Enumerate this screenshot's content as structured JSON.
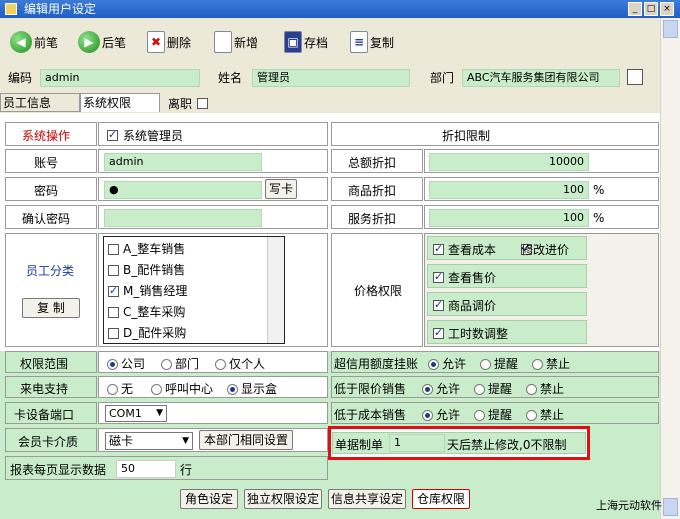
{
  "window": {
    "title": "编辑用户设定"
  },
  "toolbar": {
    "prev": "前笔",
    "next": "后笔",
    "delete": "删除",
    "add": "新增",
    "save": "存档",
    "copy": "复制"
  },
  "header": {
    "code_label": "编码",
    "code_value": "admin",
    "name_label": "姓名",
    "name_value": "管理员",
    "dept_label": "部门",
    "dept_value": "ABC汽车服务集团有限公司"
  },
  "tabs": {
    "employee": "员工信息",
    "system": "系统权限",
    "resign": "离职"
  },
  "left": {
    "sysop_label": "系统操作",
    "sysadmin_label": "系统管理员",
    "account_label": "账号",
    "account_value": "admin",
    "password_label": "密码",
    "password_value": "●",
    "write_card": "写卡",
    "confirm_label": "确认密码",
    "category_label": "员工分类",
    "copy_btn": "复 制",
    "categories": [
      {
        "label": "A_整车销售",
        "checked": false
      },
      {
        "label": "B_配件销售",
        "checked": false
      },
      {
        "label": "M_销售经理",
        "checked": true
      },
      {
        "label": "C_整车采购",
        "checked": false
      },
      {
        "label": "D_配件采购",
        "checked": false
      }
    ]
  },
  "right": {
    "discount_title": "折扣限制",
    "total_label": "总额折扣",
    "total_value": "10000",
    "goods_label": "商品折扣",
    "goods_value": "100",
    "goods_unit": "%",
    "service_label": "服务折扣",
    "service_value": "100",
    "service_unit": "%",
    "price_label": "价格权限",
    "view_cost": "查看成本",
    "modify_purchase": "修改进价",
    "view_price": "查看售价",
    "adjust_price": "商品调价",
    "adjust_hours": "工时数调整"
  },
  "bottom": {
    "scope_label": "权限范围",
    "scope_company": "公司",
    "scope_dept": "部门",
    "scope_self": "仅个人",
    "call_label": "来电支持",
    "call_none": "无",
    "call_center": "呼叫中心",
    "call_display": "显示盒",
    "port_label": "卡设备端口",
    "port_value": "COM1",
    "member_label": "会员卡介质",
    "member_value": "磁卡",
    "same_dept": "本部门相同设置",
    "per_page_label": "报表每页显示数据",
    "per_page_value": "50",
    "per_page_unit": "行",
    "credit_label": "超信用额度挂账",
    "below_limit_label": "低于限价销售",
    "below_cost_label": "低于成本销售",
    "allow": "允许",
    "remind": "提醒",
    "forbid": "禁止",
    "doc_label": "单据制单",
    "doc_value": "1",
    "doc_suffix": "天后禁止修改,0不限制"
  },
  "footer": {
    "role_btn": "角色设定",
    "independent_btn": "独立权限设定",
    "share_btn": "信息共享设定",
    "warehouse_btn": "仓库权限",
    "company": "上海元动软件"
  }
}
